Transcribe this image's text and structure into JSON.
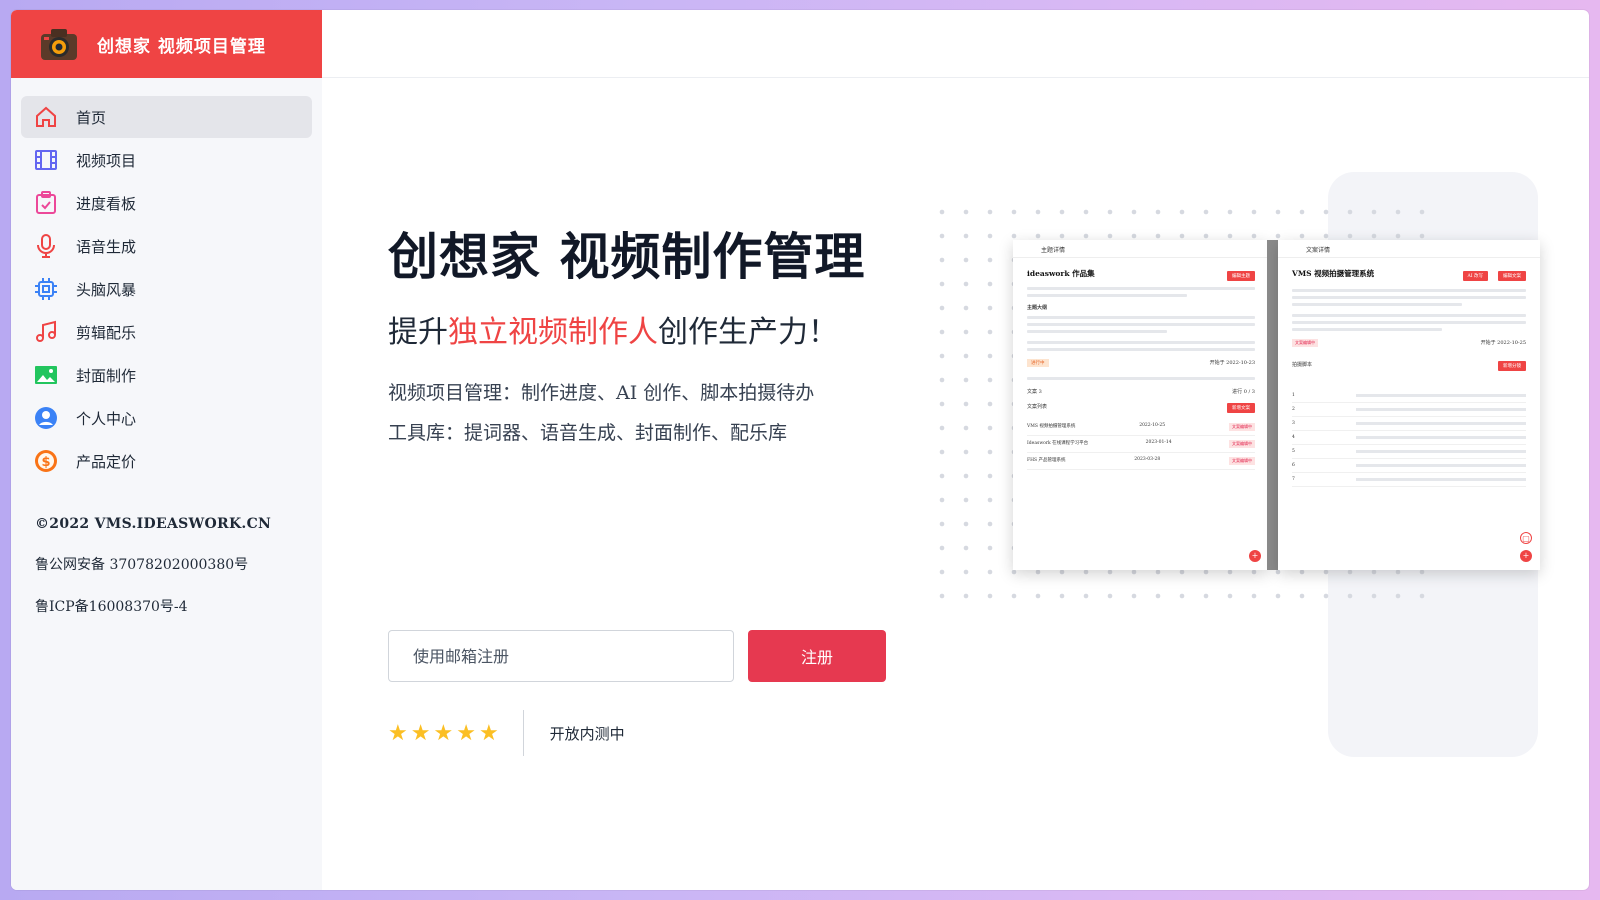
{
  "brand": {
    "title": "创想家 视频项目管理",
    "logo_icon": "camera-icon",
    "color": "#ef4444"
  },
  "sidebar": {
    "items": [
      {
        "label": "首页",
        "icon": "home-icon",
        "color": "#ef4444",
        "active": true
      },
      {
        "label": "视频项目",
        "icon": "film-icon",
        "color": "#6366f1"
      },
      {
        "label": "进度看板",
        "icon": "clipboard-check-icon",
        "color": "#ec4899"
      },
      {
        "label": "语音生成",
        "icon": "microphone-icon",
        "color": "#ef4444"
      },
      {
        "label": "头脑风暴",
        "icon": "chip-icon",
        "color": "#3b82f6"
      },
      {
        "label": "剪辑配乐",
        "icon": "music-icon",
        "color": "#ef4444"
      },
      {
        "label": "封面制作",
        "icon": "image-icon",
        "color": "#22c55e"
      },
      {
        "label": "个人中心",
        "icon": "user-circle-icon",
        "color": "#3b82f6"
      },
      {
        "label": "产品定价",
        "icon": "dollar-icon",
        "color": "#f97316"
      }
    ],
    "footer": {
      "copyright": "©2022 VMS.IDEASWORK.CN",
      "police": "鲁公网安备 37078202000380号",
      "icp": "鲁ICP备16008370号-4"
    }
  },
  "hero": {
    "title": "创想家 视频制作管理",
    "subtitle_pre": "提升",
    "subtitle_highlight": "独立视频制作人",
    "subtitle_post": "创作生产力！",
    "feature1": "视频项目管理：制作进度、AI 创作、脚本拍摄待办",
    "feature2": "工具库：提词器、语音生成、封面制作、配乐库",
    "highlight_color": "#ef4444"
  },
  "signup": {
    "placeholder": "使用邮箱注册",
    "value": "",
    "button_label": "注册",
    "button_color": "#e63950"
  },
  "rating": {
    "stars": 5,
    "star_glyph": "★",
    "text": "开放内测中"
  },
  "preview": {
    "left": {
      "header": "主题详情",
      "title": "ideaswork 作品集",
      "button": "编辑主题",
      "section": "主题大纲",
      "tag": "进行中",
      "date": "开始于 2022-10-23",
      "count_label": "文案 3",
      "progress": "进行 0 / 3",
      "list_title": "文案列表",
      "add_button": "新增文案",
      "rows": [
        {
          "name": "VMS 视频拍摄管理系统",
          "date": "2022-10-25",
          "status": "文案编辑中"
        },
        {
          "name": "Ideaswork 在线课程学习平台",
          "date": "2023-01-14",
          "status": "文案编辑中"
        },
        {
          "name": "FHS 产品管理系统",
          "date": "2023-03-28",
          "status": "文案编辑中"
        }
      ]
    },
    "right": {
      "header": "文案详情",
      "title": "VMS 视频拍摄管理系统",
      "button1": "AI 改写",
      "button2": "编辑文案",
      "tag": "文案编辑中",
      "date": "开始于 2022-10-25",
      "section": "拍摄脚本",
      "add_button": "新增分镜",
      "rows": [
        "1",
        "2",
        "3",
        "4",
        "5",
        "6",
        "7"
      ]
    }
  }
}
